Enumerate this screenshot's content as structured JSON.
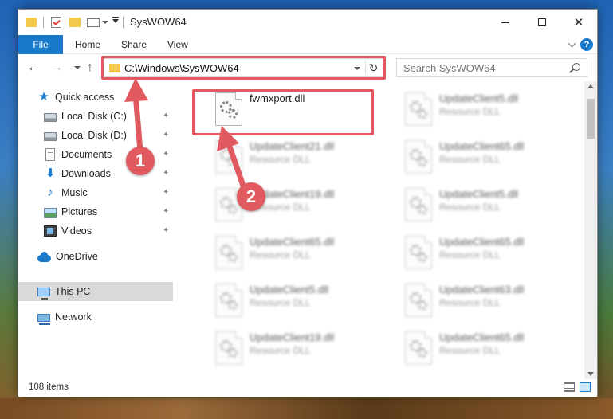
{
  "window": {
    "title": "SysWOW64"
  },
  "ribbon": {
    "tabs": [
      "File",
      "Home",
      "Share",
      "View"
    ],
    "help": "?"
  },
  "navbar": {
    "address": "C:\\Windows\\SysWOW64",
    "search_placeholder": "Search SysWOW64"
  },
  "sidebar": {
    "items": [
      {
        "label": "Quick access",
        "icon": "star-icon"
      },
      {
        "label": "Local Disk (C:)",
        "icon": "drive-icon",
        "pinned": true
      },
      {
        "label": "Local Disk (D:)",
        "icon": "drive-icon",
        "pinned": true
      },
      {
        "label": "Documents",
        "icon": "documents-icon",
        "pinned": true
      },
      {
        "label": "Downloads",
        "icon": "download-icon",
        "pinned": true
      },
      {
        "label": "Music",
        "icon": "music-icon",
        "pinned": true
      },
      {
        "label": "Pictures",
        "icon": "pictures-icon",
        "pinned": true
      },
      {
        "label": "Videos",
        "icon": "videos-icon",
        "pinned": true
      },
      {
        "label": "OneDrive",
        "icon": "cloud-icon"
      },
      {
        "label": "This PC",
        "icon": "computer-icon",
        "selected": true
      },
      {
        "label": "Network",
        "icon": "network-icon"
      }
    ]
  },
  "files": [
    {
      "name": "fwmxport.dll",
      "type": ""
    },
    {
      "name": "UpdateClient5.dll",
      "type": "Resource DLL"
    },
    {
      "name": "UpdateClient21.dll",
      "type": "Resource DLL"
    },
    {
      "name": "UpdateClient65.dll",
      "type": "Resource DLL"
    },
    {
      "name": "UpdateClient19.dll",
      "type": "Resource DLL"
    },
    {
      "name": "UpdateClient5.dll",
      "type": "Resource DLL"
    },
    {
      "name": "UpdateClient65.dll",
      "type": "Resource DLL"
    },
    {
      "name": "UpdateClient65.dll",
      "type": "Resource DLL"
    },
    {
      "name": "UpdateClient5.dll",
      "type": "Resource DLL"
    },
    {
      "name": "UpdateClient63.dll",
      "type": "Resource DLL"
    },
    {
      "name": "UpdateClient19.dll",
      "type": "Resource DLL"
    },
    {
      "name": "UpdateClient65.dll",
      "type": "Resource DLL"
    }
  ],
  "status": {
    "item_count": "108 items"
  },
  "annotations": {
    "step1": "1",
    "step2": "2",
    "color": "#e05a5f"
  },
  "colors": {
    "accent": "#1979ca"
  }
}
